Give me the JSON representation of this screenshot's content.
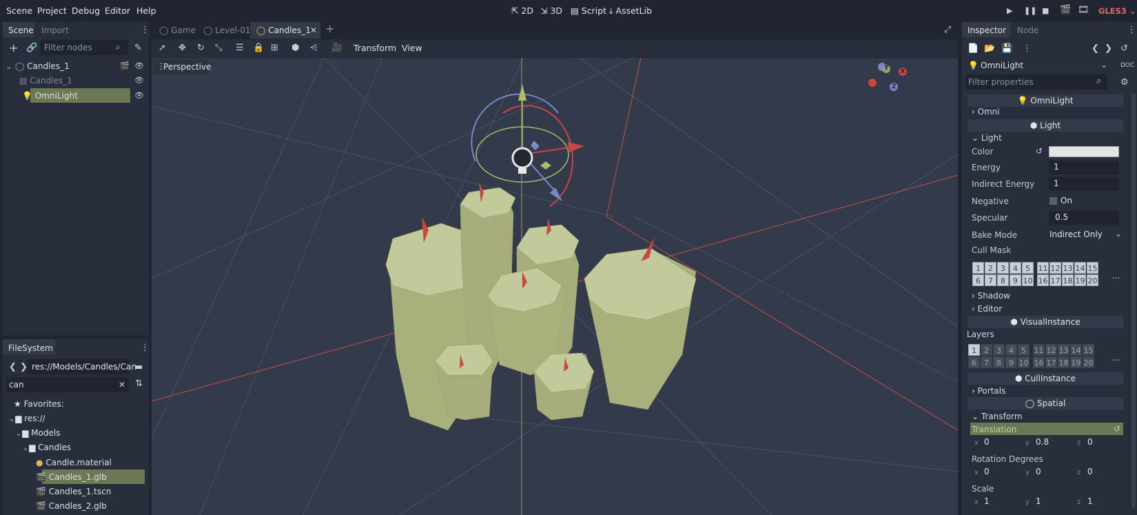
{
  "menu": [
    "Scene",
    "Project",
    "Debug",
    "Editor",
    "Help"
  ],
  "workspaces": {
    "w2d": "2D",
    "w3d": "3D",
    "script": "Script",
    "assetlib": "AssetLib"
  },
  "renderer": "GLES3",
  "scene_dock": {
    "tabs": [
      "Scene",
      "Import"
    ],
    "filter_placeholder": "Filter nodes",
    "nodes": [
      {
        "label": "Candles_1"
      },
      {
        "label": "Candles_1"
      },
      {
        "label": "OmniLight"
      }
    ]
  },
  "filesystem": {
    "tab": "FileSystem",
    "path": "res://Models/Candles/Can",
    "search": "can",
    "items": [
      "Favorites:",
      "res://",
      "Models",
      "Candles",
      "Candle.material",
      "Candles_1.glb",
      "Candles_1.tscn",
      "Candles_2.glb"
    ]
  },
  "editor_tabs": [
    "Game",
    "Level-01",
    "Candles_1"
  ],
  "viewport": {
    "toolbar_menus": {
      "transform": "Transform",
      "view": "View"
    },
    "perspective": "Perspective",
    "gizmo": {
      "x": "X",
      "y": "Y",
      "z": "Z"
    }
  },
  "inspector": {
    "tabs": [
      "Inspector",
      "Node"
    ],
    "node_name": "OmniLight",
    "filter_placeholder": "Filter properties",
    "sections": {
      "omnilight": "OmniLight",
      "omni": "Omni",
      "light": "Light",
      "light_sub": "Light",
      "shadow": "Shadow",
      "editor": "Editor",
      "visualinstance": "VisualInstance",
      "layers": "Layers",
      "cullinstance": "CullInstance",
      "portals": "Portals",
      "spatial": "Spatial",
      "transform": "Transform"
    },
    "props": {
      "color": "Color",
      "energy": "Energy",
      "energy_val": "1",
      "indirect": "Indirect Energy",
      "indirect_val": "1",
      "negative": "Negative",
      "negative_val": "On",
      "specular": "Specular",
      "specular_val": "0.5",
      "bake": "Bake Mode",
      "bake_val": "Indirect Only",
      "cull": "Cull Mask",
      "translation": "Translation",
      "rotation": "Rotation Degrees",
      "scale": "Scale"
    },
    "light_color": "#e4e4e0",
    "mask_rows": [
      [
        "1",
        "2",
        "3",
        "4",
        "5",
        "11",
        "12",
        "13",
        "14",
        "15"
      ],
      [
        "6",
        "7",
        "8",
        "9",
        "10",
        "16",
        "17",
        "18",
        "19",
        "20"
      ]
    ],
    "translation": {
      "x": "0",
      "y": "0.8",
      "z": "0"
    },
    "rotation": {
      "x": "0",
      "y": "0",
      "z": "0"
    },
    "scale": {
      "x": "1",
      "y": "1",
      "z": "1"
    },
    "more": "..."
  }
}
